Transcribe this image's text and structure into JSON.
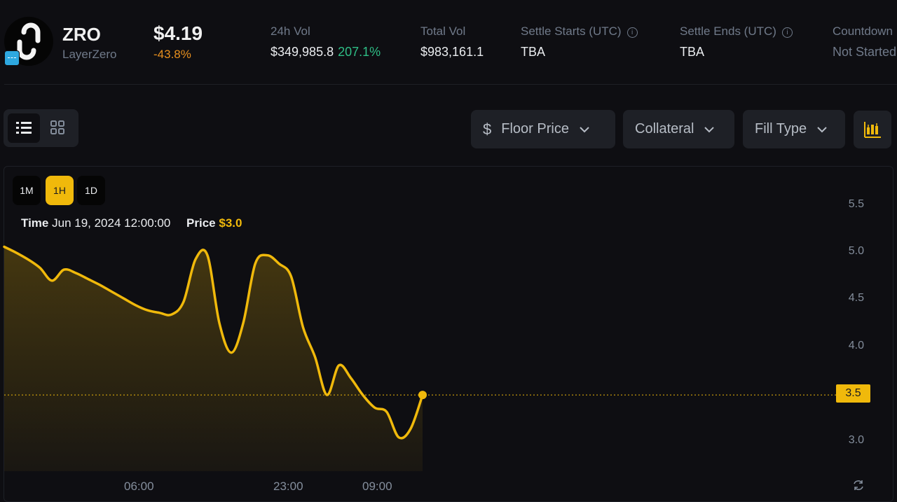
{
  "token": {
    "symbol": "ZRO",
    "name": "LayerZero",
    "price": "$4.19",
    "change": "-43.8%",
    "logo_icon": "layerzero-logo",
    "badge_icon": "chain-badge"
  },
  "stats": {
    "vol24h_label": "24h Vol",
    "vol24h_value": "$349,985.8",
    "vol24h_change": "207.1%",
    "total_vol_label": "Total Vol",
    "total_vol_value": "$983,161.1",
    "settle_start_label": "Settle Starts (UTC)",
    "settle_start_value": "TBA",
    "settle_end_label": "Settle Ends (UTC)",
    "settle_end_value": "TBA",
    "countdown_label": "Countdown",
    "countdown_value": "Not Started"
  },
  "toolbar": {
    "view_list_icon": "list-icon",
    "view_grid_icon": "grid-icon",
    "floor_price_label": "Floor Price",
    "floor_price_icon": "$",
    "collateral_label": "Collateral",
    "fill_type_label": "Fill Type",
    "chart_icon": "candlestick-chart-icon"
  },
  "intervals": [
    "1M",
    "1H",
    "1D"
  ],
  "selected_interval": "1H",
  "tooltip": {
    "time_label": "Time",
    "time_value": "Jun 19, 2024 12:00:00",
    "price_label": "Price",
    "price_value": "$3.0"
  },
  "colors": {
    "accent": "#f0b90b",
    "positive": "#2ebd85",
    "negative": "#e8901e",
    "background": "#0e0e12",
    "panel": "#1e2026"
  },
  "chart_data": {
    "type": "area",
    "x_tick_labels": [
      "06:00",
      "23:00",
      "09:00"
    ],
    "y_tick_labels": [
      "3.0",
      "3.5",
      "4.0",
      "4.5",
      "5.0",
      "5.5"
    ],
    "ylim": [
      2.6,
      5.75
    ],
    "grid": false,
    "last_value_label": "3.5",
    "last_value": 3.5,
    "series": [
      {
        "values": [
          5.25,
          5.18,
          5.1,
          5.0,
          4.85,
          4.98,
          4.94,
          4.87,
          4.8,
          4.72,
          4.64,
          4.56,
          4.5,
          4.47,
          4.45,
          4.6,
          5.1,
          5.15,
          4.35,
          4.0,
          4.35,
          5.05,
          5.15,
          5.05,
          4.9,
          4.3,
          3.95,
          3.5,
          3.85,
          3.7,
          3.5,
          3.35,
          3.3,
          3.0,
          3.1,
          3.5
        ]
      }
    ]
  }
}
